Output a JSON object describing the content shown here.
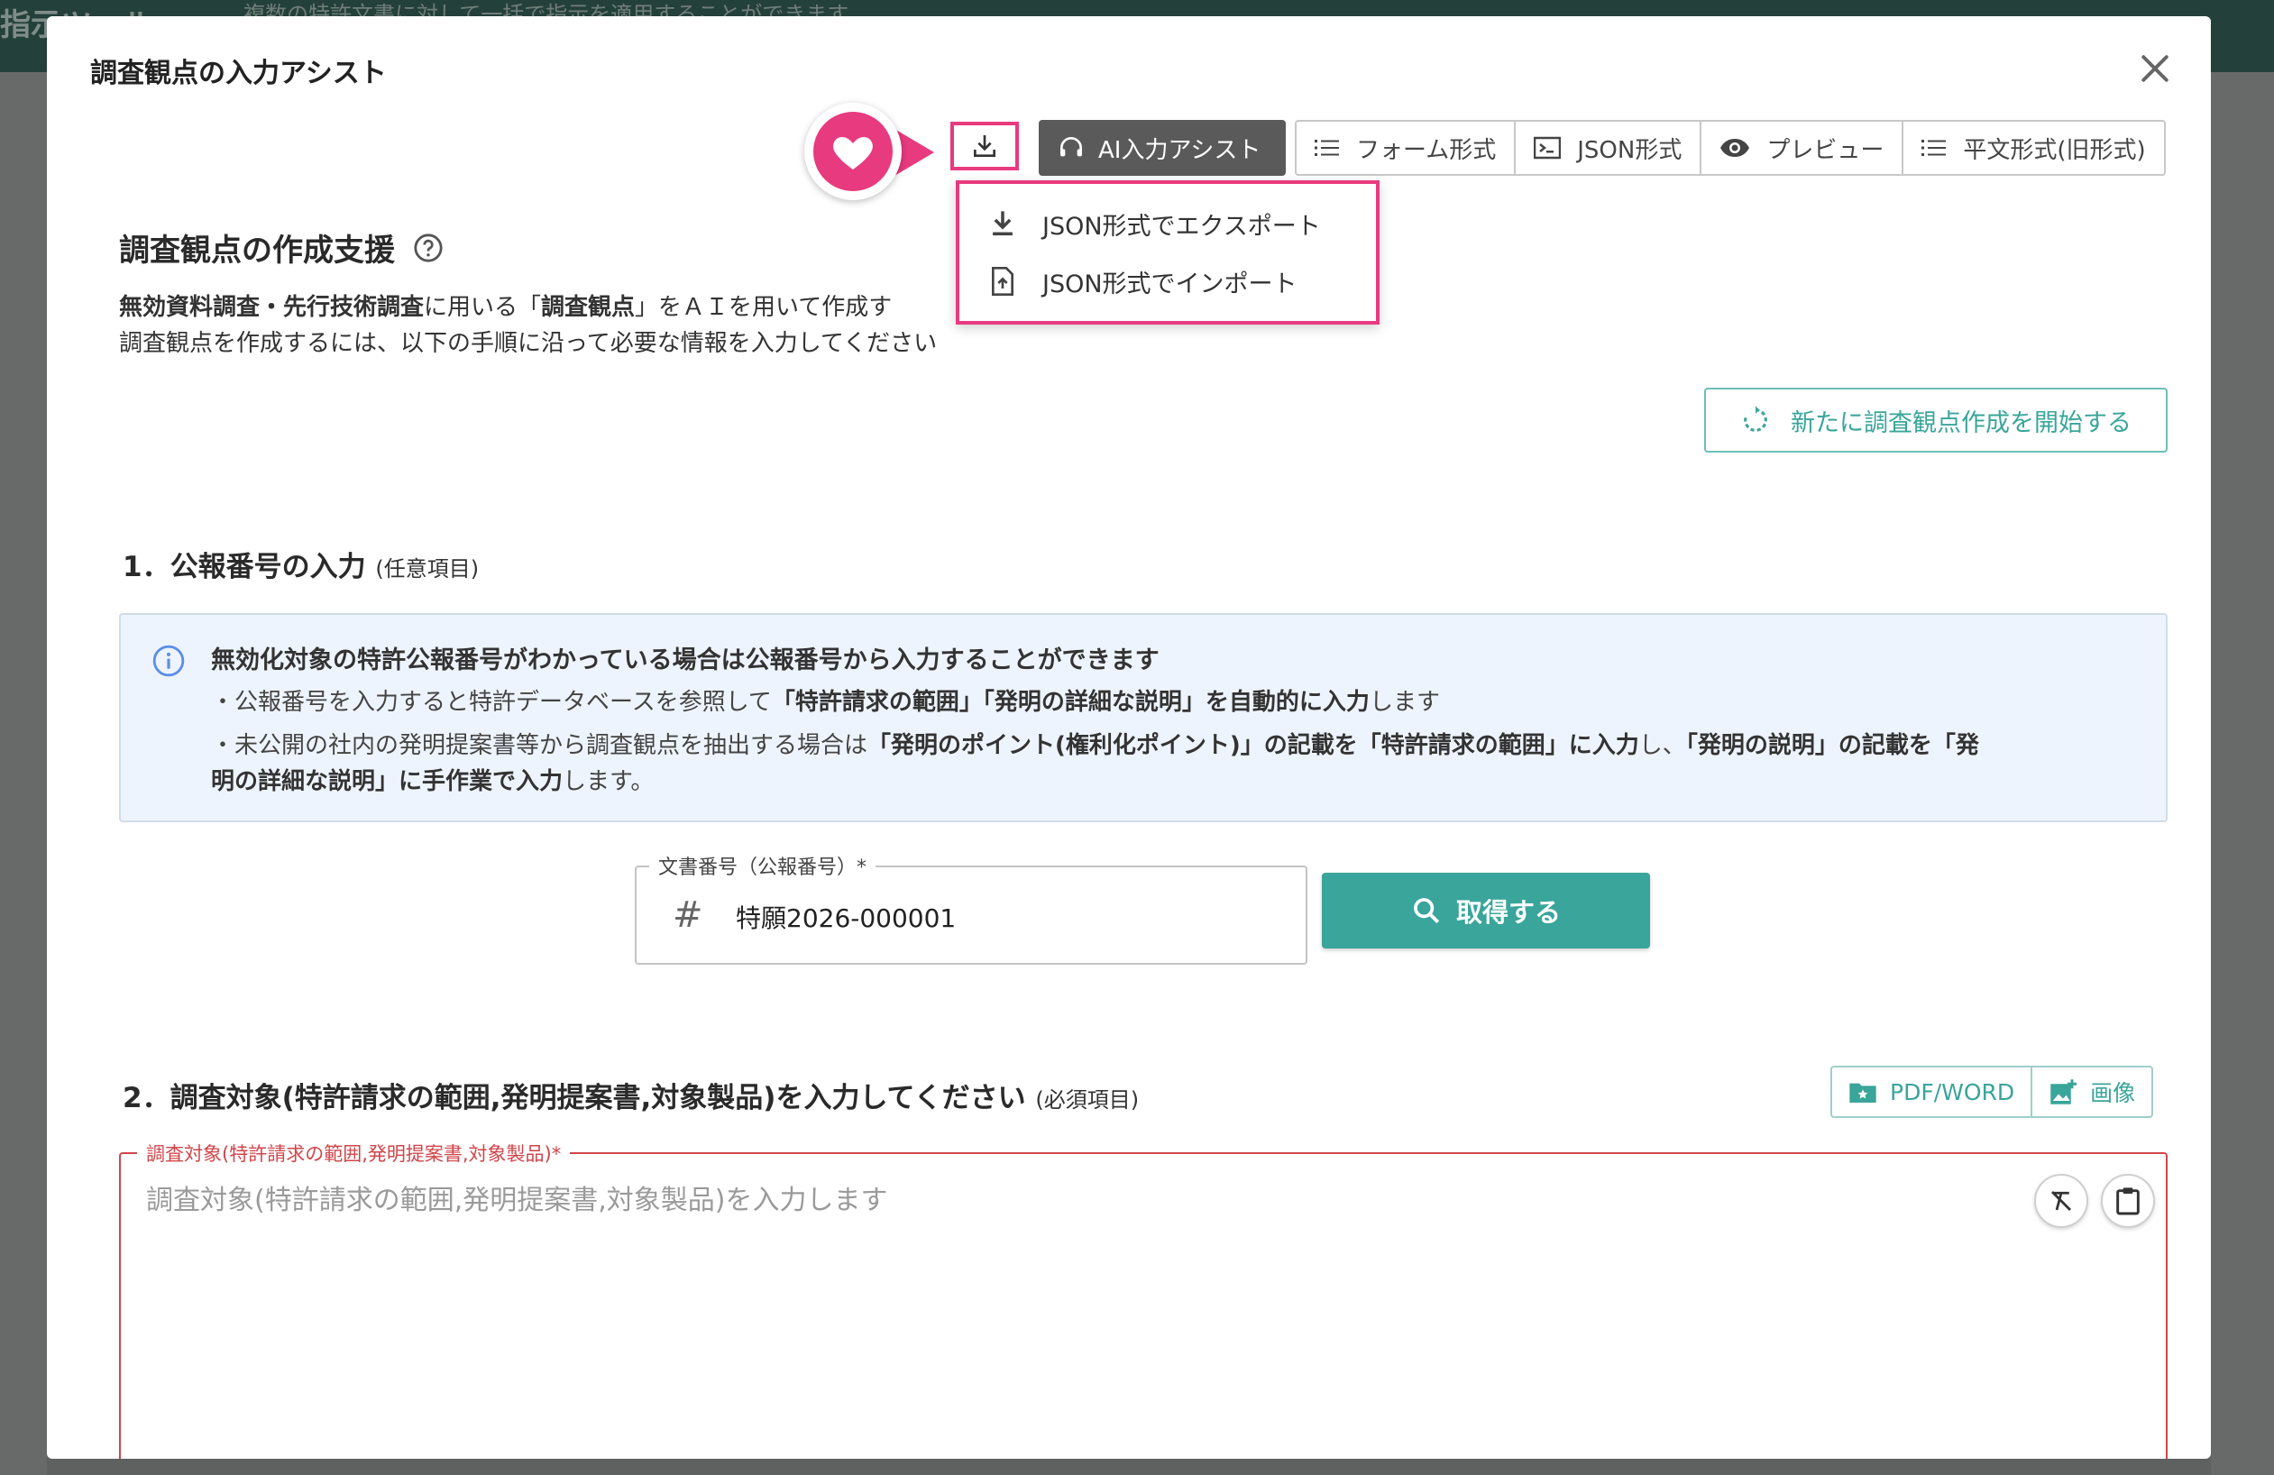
{
  "background": {
    "title": "指示ツール",
    "subtitle": "複数の特許文書に対して一括で指示を適用することができます"
  },
  "modal": {
    "title": "調査観点の入力アシスト",
    "toolbar": {
      "ai_assist_label": "AI入力アシスト",
      "tabs": [
        {
          "label": "フォーム形式",
          "icon": "list-icon"
        },
        {
          "label": "JSON形式",
          "icon": "terminal-icon"
        },
        {
          "label": "プレビュー",
          "icon": "eye-icon"
        },
        {
          "label": "平文形式(旧形式)",
          "icon": "list-icon"
        }
      ]
    },
    "dropdown": {
      "items": [
        {
          "label": "JSON形式でエクスポート",
          "icon": "download-icon"
        },
        {
          "label": "JSON形式でインポート",
          "icon": "file-upload-icon"
        }
      ]
    },
    "section": {
      "heading": "調査観点の作成支援",
      "intro_line1": {
        "bold1": "無効資料調査・先行技術調査",
        "text1": "に用いる「",
        "bold2": "調査観点",
        "text2": "」をＡＩを用いて作成す"
      },
      "intro_line2": "調査観点を作成するには、以下の手順に沿って必要な情報を入力してください",
      "restart_label": "新たに調査観点作成を開始する"
    },
    "step1": {
      "title": "1．公報番号の入力",
      "optional": "(任意項目)",
      "info_title": "無効化対象の特許公報番号がわかっている場合は公報番号から入力することができます",
      "info_line1": {
        "t1": "・公報番号を入力すると特許データベースを参照して",
        "b1": "「特許請求の範囲」「発明の詳細な説明」を自動的に入力",
        "t2": "します"
      },
      "info_line2": {
        "t1": "・未公開の社内の発明提案書等から調査観点を抽出する場合は",
        "b1": "「発明のポイント(権利化ポイント)」の記載を「特許請求の範囲」に入力",
        "t2": "し、",
        "b2": "「発明の説明」の記載を「発"
      },
      "info_line3": {
        "b1": "明の詳細な説明」に手作業で入力",
        "t1": "します。"
      },
      "doc_label": "文書番号（公報番号）*",
      "doc_value": "特願2026-000001",
      "fetch_label": "取得する"
    },
    "step2": {
      "title": "2．調査対象(特許請求の範囲,発明提案書,対象製品)を入力してください",
      "required": "(必須項目)",
      "upload_pdf": "PDF/WORD",
      "upload_image": "画像",
      "field_label": "調査対象(特許請求の範囲,発明提案書,対象製品)*",
      "placeholder": "調査対象(特許請求の範囲,発明提案書,対象製品)を入力します"
    }
  },
  "colors": {
    "accent": "#3aa59a",
    "highlight": "#e83a7e",
    "error": "#d0454b",
    "info_bg": "#eef4fd"
  }
}
